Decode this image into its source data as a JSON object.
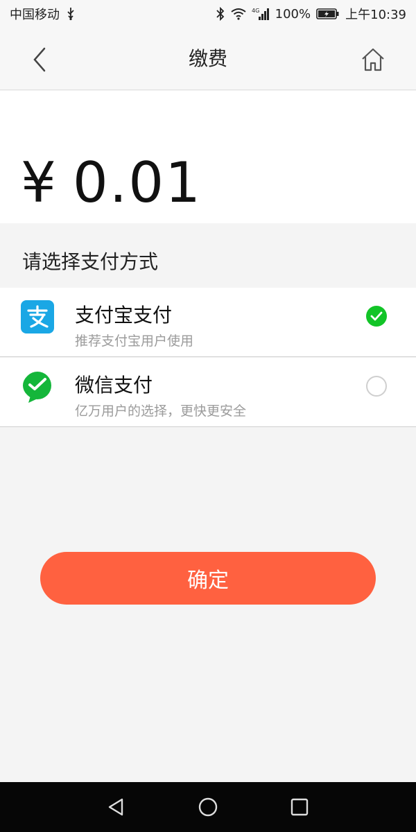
{
  "status_bar": {
    "carrier": "中国移动",
    "battery_percent": "100%",
    "time": "上午10:39",
    "network_label": "4G",
    "icons": [
      "usb-icon",
      "bluetooth-icon",
      "wifi-icon",
      "signal-icon",
      "battery-charging-icon"
    ]
  },
  "nav": {
    "title": "缴费",
    "back_icon": "back-chevron-icon",
    "home_icon": "home-icon"
  },
  "amount": {
    "currency": "¥",
    "value": "0.01"
  },
  "payment_section": {
    "label": "请选择支付方式",
    "options": [
      {
        "name": "支付宝支付",
        "desc": "推荐支付宝用户使用",
        "icon": "alipay-icon",
        "selected": true,
        "color": "#1aa7e5"
      },
      {
        "name": "微信支付",
        "desc": "亿万用户的选择，更快更安全",
        "icon": "wechat-pay-icon",
        "selected": false,
        "color": "#14b63a"
      }
    ]
  },
  "confirm_button": {
    "label": "确定",
    "color": "#ff6140"
  },
  "colors": {
    "accent": "#ff6140",
    "selected_check": "#12c427",
    "alipay_blue": "#1aa7e5",
    "wechat_green": "#14b63a"
  }
}
